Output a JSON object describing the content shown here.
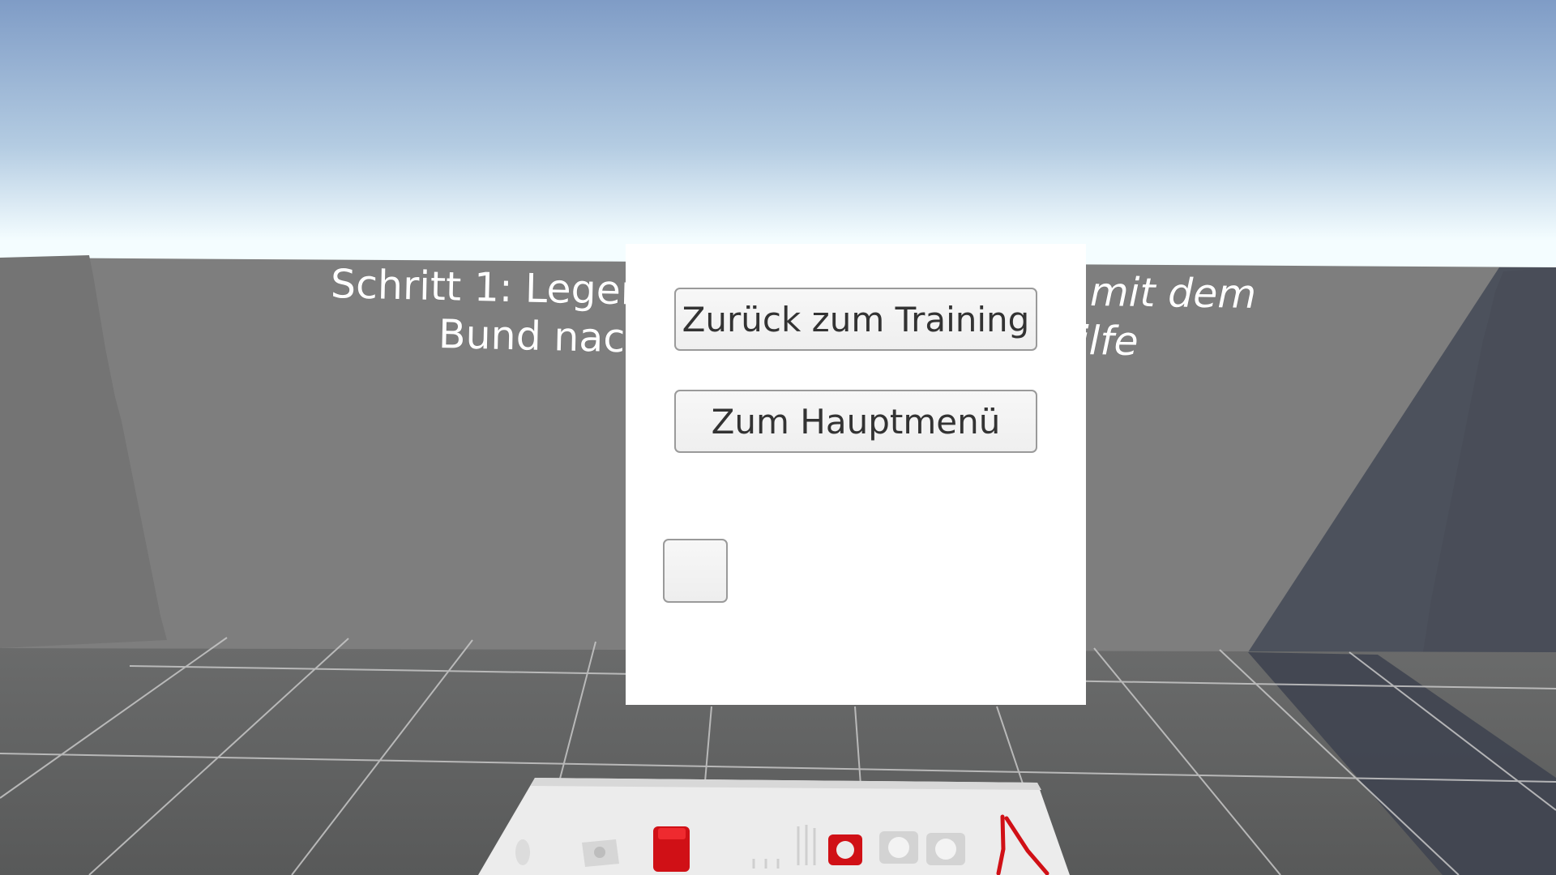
{
  "scene": {
    "colors": {
      "sky_top": "#7f9cc6",
      "sky_horizon": "#f4fdff",
      "wall": "#7e7e7e",
      "wall_shadow": "#4c515c",
      "floor": "#5e5f5f",
      "grid_line": "#c8c8c8",
      "table": "#ececec",
      "part_red": "#d01016"
    }
  },
  "instruction": {
    "left_line_1": "Schritt 1: Legen",
    "left_line_2": "Bund nach",
    "right_line_1": "mit dem",
    "right_line_2": "ilfe"
  },
  "pause_menu": {
    "resume_label": "Zurück zum Training",
    "main_menu_label": "Zum Hauptmenü"
  }
}
